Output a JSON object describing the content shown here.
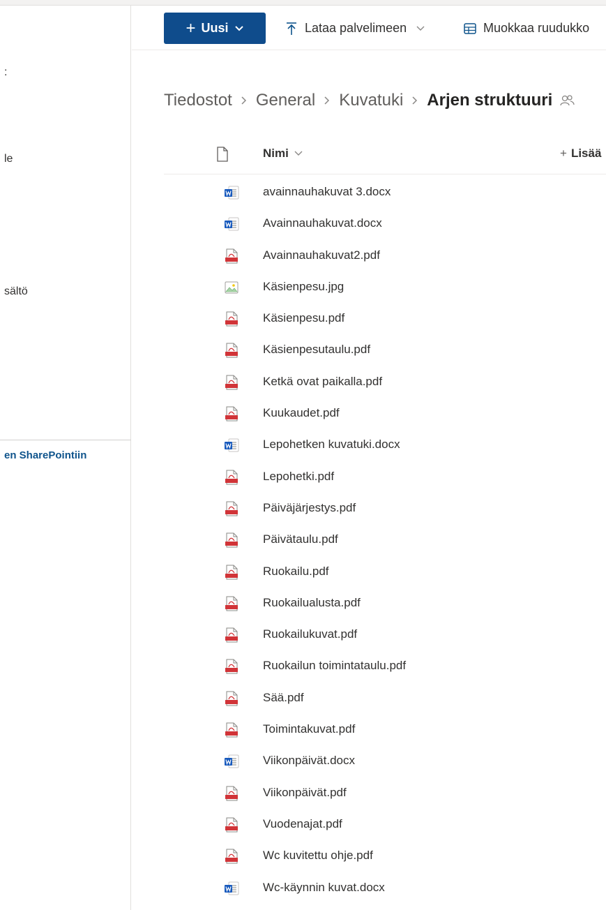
{
  "left_nav": {
    "items": [
      ":",
      "le",
      "sältö"
    ],
    "link": "en SharePointiin"
  },
  "toolbar": {
    "new_label": "Uusi",
    "upload_label": "Lataa palvelimeen",
    "grid_label": "Muokkaa ruudukko"
  },
  "breadcrumb": [
    "Tiedostot",
    "General",
    "Kuvatuki",
    "Arjen struktuuri"
  ],
  "list_header": {
    "name_label": "Nimi",
    "add_column_label": "Lisää"
  },
  "files": [
    {
      "name": "avainnauhakuvat 3.docx",
      "type": "word-icon"
    },
    {
      "name": "Avainnauhakuvat.docx",
      "type": "word-icon"
    },
    {
      "name": "Avainnauhakuvat2.pdf",
      "type": "pdf-icon"
    },
    {
      "name": "Käsienpesu.jpg",
      "type": "image-icon"
    },
    {
      "name": "Käsienpesu.pdf",
      "type": "pdf-icon"
    },
    {
      "name": "Käsienpesutaulu.pdf",
      "type": "pdf-icon"
    },
    {
      "name": "Ketkä ovat paikalla.pdf",
      "type": "pdf-icon"
    },
    {
      "name": "Kuukaudet.pdf",
      "type": "pdf-icon"
    },
    {
      "name": "Lepohetken kuvatuki.docx",
      "type": "word-icon"
    },
    {
      "name": "Lepohetki.pdf",
      "type": "pdf-icon"
    },
    {
      "name": "Päiväjärjestys.pdf",
      "type": "pdf-icon"
    },
    {
      "name": "Päivätaulu.pdf",
      "type": "pdf-icon"
    },
    {
      "name": "Ruokailu.pdf",
      "type": "pdf-icon"
    },
    {
      "name": "Ruokailualusta.pdf",
      "type": "pdf-icon"
    },
    {
      "name": "Ruokailukuvat.pdf",
      "type": "pdf-icon"
    },
    {
      "name": "Ruokailun toimintataulu.pdf",
      "type": "pdf-icon"
    },
    {
      "name": "Sää.pdf",
      "type": "pdf-icon"
    },
    {
      "name": "Toimintakuvat.pdf",
      "type": "pdf-icon"
    },
    {
      "name": "Viikonpäivät.docx",
      "type": "word-icon"
    },
    {
      "name": "Viikonpäivät.pdf",
      "type": "pdf-icon"
    },
    {
      "name": "Vuodenajat.pdf",
      "type": "pdf-icon"
    },
    {
      "name": "Wc kuvitettu ohje.pdf",
      "type": "pdf-icon"
    },
    {
      "name": "Wc-käynnin kuvat.docx",
      "type": "word-icon"
    }
  ],
  "colors": {
    "primary_button": "#0f4c8c",
    "word_icon": "#185abd",
    "pdf_icon": "#d13438",
    "link": "#0f548c"
  }
}
